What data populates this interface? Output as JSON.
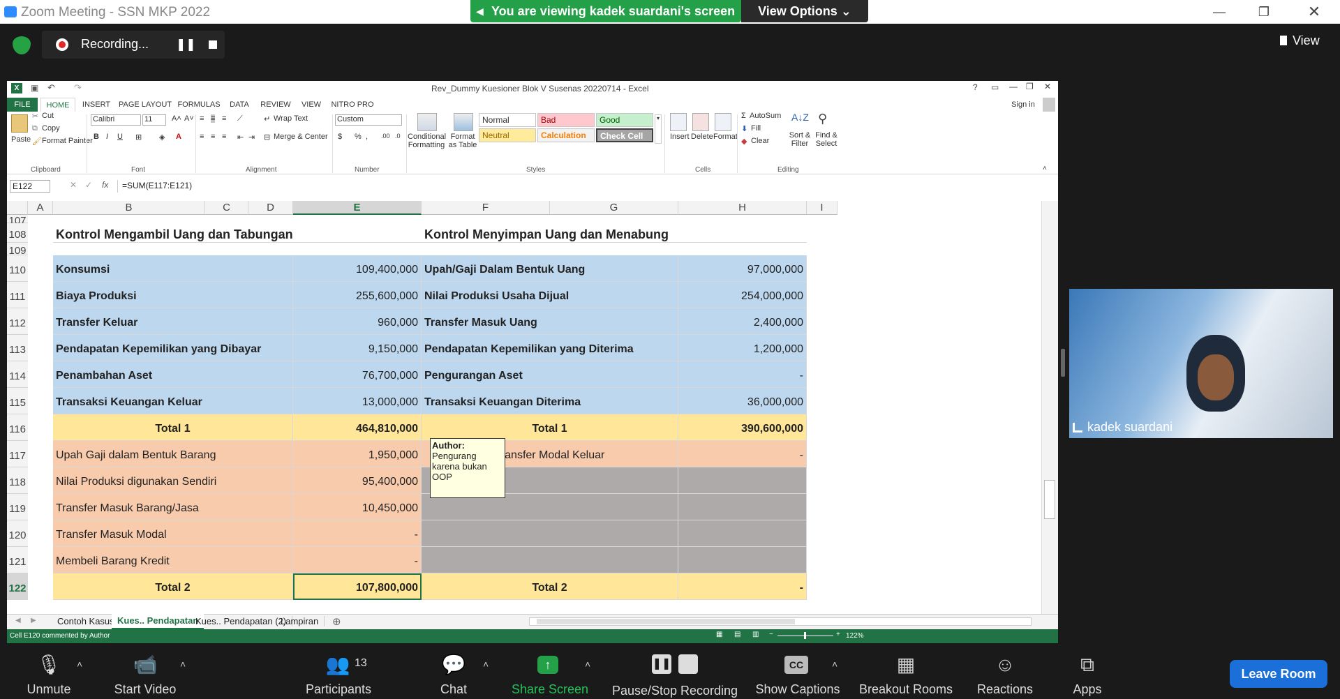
{
  "zoom": {
    "window_title": "Zoom Meeting - SSN MKP 2022",
    "sharing_banner": "You are viewing kadek suardani's screen",
    "view_options": "View Options ⌄",
    "recording_label": "Recording...",
    "view_button": "View",
    "participant_name": "kadek suardani",
    "participants_count": "13",
    "toolbar": {
      "unmute": "Unmute",
      "start_video": "Start Video",
      "participants": "Participants",
      "chat": "Chat",
      "share_screen": "Share Screen",
      "pause_stop_recording": "Pause/Stop Recording",
      "show_captions": "Show Captions",
      "breakout_rooms": "Breakout Rooms",
      "reactions": "Reactions",
      "apps": "Apps",
      "leave_room": "Leave Room"
    },
    "colors": {
      "share_green": "#24a148",
      "leave_blue": "#1b6fd8"
    }
  },
  "excel": {
    "title": "Rev_Dummy Kuesioner Blok V Susenas 20220714 - Excel",
    "sign_in": "Sign in",
    "tabs": [
      "FILE",
      "HOME",
      "INSERT",
      "PAGE LAYOUT",
      "FORMULAS",
      "DATA",
      "REVIEW",
      "VIEW",
      "NITRO PRO"
    ],
    "ribbon": {
      "paste": "Paste",
      "cut": "Cut",
      "copy": "Copy",
      "format_painter": "Format Painter",
      "clipboard": "Clipboard",
      "font_name": "Calibri",
      "font_size": "11",
      "font_group": "Font",
      "wrap_text": "Wrap Text",
      "merge_center": "Merge & Center",
      "alignment": "Alignment",
      "number_format": "Custom",
      "number": "Number",
      "conditional_formatting": "Conditional Formatting",
      "format_as_table": "Format as Table",
      "style_normal": "Normal",
      "style_bad": "Bad",
      "style_good": "Good",
      "style_neutral": "Neutral",
      "style_calculation": "Calculation",
      "style_check_cell": "Check Cell",
      "styles": "Styles",
      "insert": "Insert",
      "delete": "Delete",
      "format": "Format",
      "cells": "Cells",
      "autosum": "AutoSum",
      "fill": "Fill",
      "clear": "Clear",
      "sort_filter": "Sort & Filter",
      "find_select": "Find & Select",
      "editing": "Editing"
    },
    "name_box": "E122",
    "formula": "=SUM(E117:E121)",
    "columns": [
      "A",
      "B",
      "C",
      "D",
      "E",
      "F",
      "G",
      "H",
      "I"
    ],
    "rows": [
      "107",
      "108",
      "109",
      "110",
      "111",
      "112",
      "113",
      "114",
      "115",
      "116",
      "117",
      "118",
      "119",
      "120",
      "121",
      "122"
    ],
    "left_header": "Kontrol Mengambil Uang dan Tabungan",
    "right_header": "Kontrol Menyimpan Uang dan Menabung",
    "left_items": [
      {
        "label": "Konsumsi",
        "value": "109,400,000"
      },
      {
        "label": "Biaya Produksi",
        "value": "255,600,000"
      },
      {
        "label": "Transfer Keluar",
        "value": "960,000"
      },
      {
        "label": "Pendapatan Kepemilikan yang Dibayar",
        "value": "9,150,000"
      },
      {
        "label": "Penambahan Aset",
        "value": "76,700,000"
      },
      {
        "label": "Transaksi Keuangan Keluar",
        "value": "13,000,000"
      }
    ],
    "right_items": [
      {
        "label": "Upah/Gaji Dalam Bentuk Uang",
        "value": "97,000,000"
      },
      {
        "label": "Nilai Produksi Usaha Dijual",
        "value": "254,000,000"
      },
      {
        "label": "Transfer Masuk Uang",
        "value": "2,400,000"
      },
      {
        "label": "Pendapatan Kepemilikan yang Diterima",
        "value": "1,200,000"
      },
      {
        "label": "Pengurangan Aset",
        "value": "-"
      },
      {
        "label": "Transaksi Keuangan Diterima",
        "value": "36,000,000"
      }
    ],
    "total1_label": "Total 1",
    "total1_left": "464,810,000",
    "total1_right": "390,600,000",
    "left_items2": [
      {
        "label": "Upah Gaji dalam Bentuk Barang",
        "value": "1,950,000"
      },
      {
        "label": "Nilai Produksi digunakan Sendiri",
        "value": "95,400,000"
      },
      {
        "label": "Transfer Masuk Barang/Jasa",
        "value": "10,450,000"
      },
      {
        "label": "Transfer Masuk Modal",
        "value": "-"
      },
      {
        "label": "Membeli Barang Kredit",
        "value": "-"
      }
    ],
    "right_item2": {
      "label": "Transfer Modal Keluar",
      "value": "-"
    },
    "total2_label": "Total 2",
    "total2_left": "107,800,000",
    "total2_right": "-",
    "comment": {
      "author": "Author:",
      "text": "Pengurang karena bukan OOP"
    },
    "sheets": [
      "Contoh Kasus",
      "Kues.. Pendapatan",
      "Kues.. Pendapatan (2)",
      "Lampiran"
    ],
    "status_left": "Cell E120 commented by Author",
    "zoom_level": "122%",
    "colors": {
      "blue": "#bdd7ee",
      "yellow": "#ffe699",
      "peach": "#f8cbad",
      "gray": "#aeaaaa",
      "excel_green": "#217346"
    }
  }
}
